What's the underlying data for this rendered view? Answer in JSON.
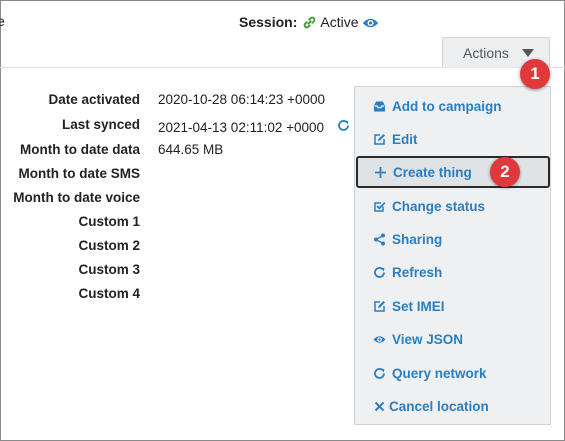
{
  "header": {
    "fragment": "e",
    "session_label": "Session:",
    "session_value": "Active",
    "actions_label": "Actions"
  },
  "details": [
    {
      "label": "Date activated",
      "value": "2020-10-28 06:14:23 +0000"
    },
    {
      "label": "Last synced",
      "value": "2021-04-13 02:11:02 +0000"
    },
    {
      "label": "Month to date data",
      "value": "644.65 MB"
    },
    {
      "label": "Month to date SMS",
      "value": ""
    },
    {
      "label": "Month to date voice",
      "value": ""
    },
    {
      "label": "Custom 1",
      "value": ""
    },
    {
      "label": "Custom 2",
      "value": ""
    },
    {
      "label": "Custom 3",
      "value": ""
    },
    {
      "label": "Custom 4",
      "value": ""
    }
  ],
  "menu": {
    "items": [
      {
        "label": "Add to campaign",
        "icon": "inbox-icon"
      },
      {
        "label": "Edit",
        "icon": "edit-icon"
      },
      {
        "label": "Create thing",
        "icon": "plus-icon",
        "selected": true
      },
      {
        "label": "Change status",
        "icon": "check-square-icon"
      },
      {
        "label": "Sharing",
        "icon": "share-icon"
      },
      {
        "label": "Refresh",
        "icon": "refresh-icon"
      },
      {
        "label": "Set IMEI",
        "icon": "edit-icon"
      },
      {
        "label": "View JSON",
        "icon": "eye-icon"
      },
      {
        "label": "Query network",
        "icon": "refresh-icon"
      },
      {
        "label": "Cancel location",
        "icon": "close-icon"
      }
    ]
  },
  "callouts": [
    "1",
    "2"
  ],
  "colors": {
    "link": "#2a7ec3",
    "session_icon": "#3c9a2a",
    "callout": "#e0393b",
    "menu_bg": "#eef0f2"
  }
}
